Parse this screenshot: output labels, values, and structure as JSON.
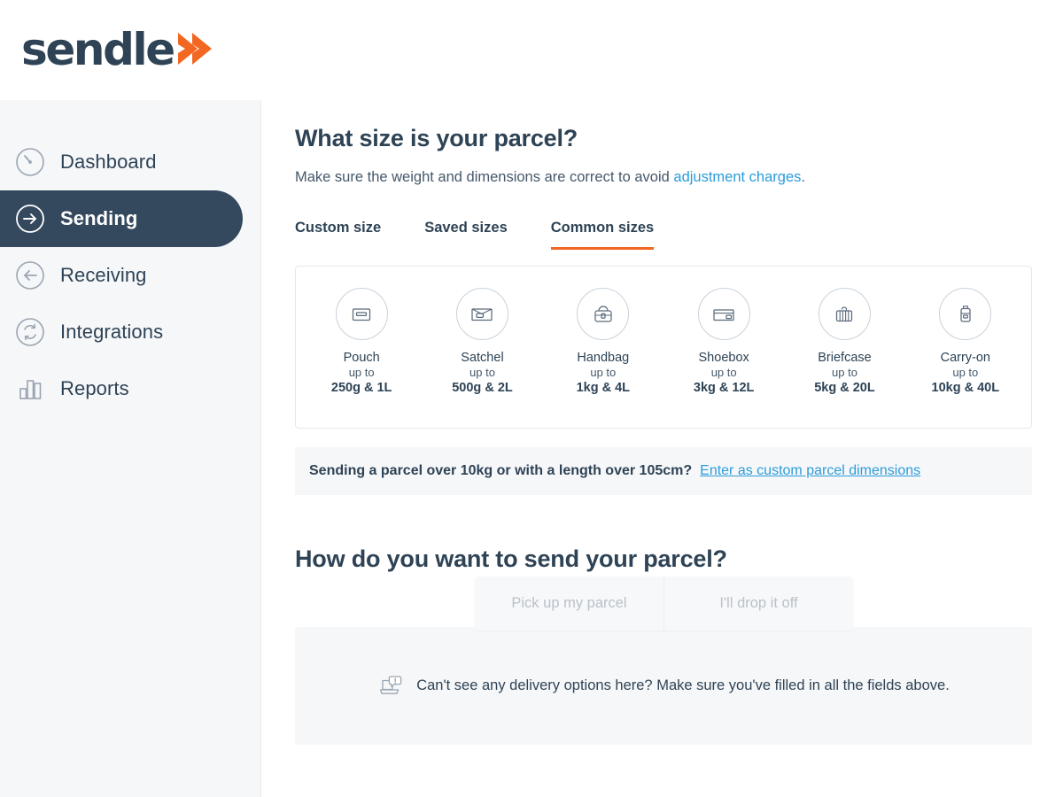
{
  "brand": {
    "logo_text": "sendle",
    "logo_icon": "chevron-right-icon",
    "navy": "#2e4355",
    "orange": "#f26722",
    "link_blue": "#2b9cdb"
  },
  "sidebar": {
    "items": [
      {
        "label": "Dashboard",
        "icon": "gauge-icon",
        "active": false
      },
      {
        "label": "Sending",
        "icon": "arrow-right-circle-icon",
        "active": true
      },
      {
        "label": "Receiving",
        "icon": "arrow-left-circle-icon",
        "active": false
      },
      {
        "label": "Integrations",
        "icon": "sync-circle-icon",
        "active": false
      },
      {
        "label": "Reports",
        "icon": "bar-chart-icon",
        "active": false
      }
    ]
  },
  "main": {
    "page_title": "What size is your parcel?",
    "subtitle_before": "Make sure the weight and dimensions are correct to avoid ",
    "subtitle_link": "adjustment charges",
    "subtitle_after": ".",
    "tabs": [
      {
        "label": "Custom size",
        "active": false
      },
      {
        "label": "Saved sizes",
        "active": false
      },
      {
        "label": "Common sizes",
        "active": true
      }
    ],
    "sizes": [
      {
        "name": "Pouch",
        "upto": "up to",
        "limit": "250g & 1L",
        "icon": "pouch-icon"
      },
      {
        "name": "Satchel",
        "upto": "up to",
        "limit": "500g & 2L",
        "icon": "satchel-icon"
      },
      {
        "name": "Handbag",
        "upto": "up to",
        "limit": "1kg & 4L",
        "icon": "handbag-icon"
      },
      {
        "name": "Shoebox",
        "upto": "up to",
        "limit": "3kg & 12L",
        "icon": "shoebox-icon"
      },
      {
        "name": "Briefcase",
        "upto": "up to",
        "limit": "5kg & 20L",
        "icon": "briefcase-icon"
      },
      {
        "name": "Carry-on",
        "upto": "up to",
        "limit": "10kg & 40L",
        "icon": "carryon-icon"
      }
    ],
    "notice": {
      "text": "Sending a parcel over 10kg or with a length over 105cm?",
      "link": "Enter as custom parcel dimensions"
    },
    "send_section": {
      "title": "How do you want to send your parcel?",
      "options": [
        {
          "label": "Pick up my parcel",
          "selected": false
        },
        {
          "label": "I'll drop it off",
          "selected": false
        }
      ],
      "empty_message": "Can't see any delivery options here? Make sure you've filled in all the fields above.",
      "empty_icon": "laptop-alert-icon"
    }
  }
}
